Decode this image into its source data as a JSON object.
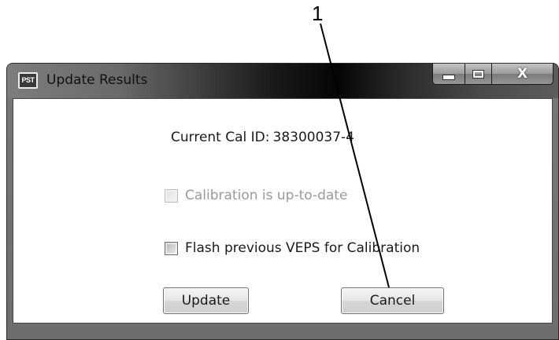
{
  "callout": {
    "number": "1"
  },
  "window": {
    "title": "Update Results",
    "app_icon_text": "PST",
    "controls": {
      "minimize_icon": "minimize-icon",
      "maximize_icon": "maximize-icon",
      "close_label": "X"
    }
  },
  "content": {
    "cal_id_label": "Current Cal ID:",
    "cal_id_value": "38300037-4",
    "checkboxes": [
      {
        "label": "Calibration is up-to-date",
        "checked": false,
        "enabled": false
      },
      {
        "label": "Flash previous VEPS for Calibration",
        "checked": false,
        "enabled": true
      }
    ],
    "buttons": {
      "update_label": "Update",
      "cancel_label": "Cancel"
    }
  }
}
